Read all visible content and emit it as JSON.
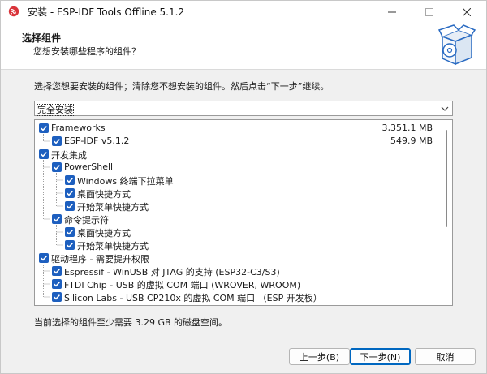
{
  "window": {
    "title": "安装 - ESP-IDF Tools Offline 5.1.2",
    "controls": {
      "minimize": "—",
      "maximize": "☐",
      "close": "✕"
    }
  },
  "header": {
    "title": "选择组件",
    "subtitle": "您想安装哪些程序的组件？",
    "icon": "installer-package-icon"
  },
  "instruction": "选择您想要安装的组件；清除您不想安装的组件。然后点击“下一步”继续。",
  "install_type": {
    "selected": "完全安装"
  },
  "components": [
    {
      "label": "Frameworks",
      "size": "3,351.1 MB",
      "checked": true
    },
    {
      "label": "ESP-IDF v5.1.2",
      "size": "549.9 MB",
      "checked": true
    },
    {
      "label": "开发集成",
      "size": "",
      "checked": true
    },
    {
      "label": "PowerShell",
      "size": "",
      "checked": true
    },
    {
      "label": "Windows 终端下拉菜单",
      "size": "",
      "checked": true
    },
    {
      "label": "桌面快捷方式",
      "size": "",
      "checked": true
    },
    {
      "label": "开始菜单快捷方式",
      "size": "",
      "checked": true
    },
    {
      "label": "命令提示符",
      "size": "",
      "checked": true
    },
    {
      "label": "桌面快捷方式",
      "size": "",
      "checked": true
    },
    {
      "label": "开始菜单快捷方式",
      "size": "",
      "checked": true
    },
    {
      "label": "驱动程序 - 需要提升权限",
      "size": "",
      "checked": true
    },
    {
      "label": "Espressif - WinUSB 对 JTAG 的支持 (ESP32-C3/S3)",
      "size": "",
      "checked": true
    },
    {
      "label": "FTDI Chip - USB 的虚拟 COM 端口 (WROVER, WROOM)",
      "size": "",
      "checked": true
    },
    {
      "label": "Silicon Labs - USB CP210x 的虚拟 COM 端口 （ESP 开发板）",
      "size": "",
      "checked": true
    }
  ],
  "disk_space": "当前选择的组件至少需要 3.29 GB 的磁盘空间。",
  "buttons": {
    "back": "上一步(B)",
    "next": "下一步(N)",
    "cancel": "取消"
  },
  "colors": {
    "checkbox": "#1d5fbf",
    "default_button_border": "#0067c0",
    "app_icon": "#d9343a"
  }
}
